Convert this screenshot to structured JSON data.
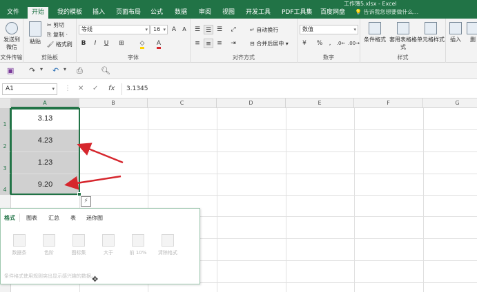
{
  "window": {
    "title": "工作簿5.xlsx - Excel"
  },
  "tabs": [
    "文件",
    "开始",
    "我的模板",
    "插入",
    "页面布局",
    "公式",
    "数据",
    "审阅",
    "视图",
    "开发工具",
    "PDF工具集",
    "百度网盘"
  ],
  "active_tab": "开始",
  "tell_me": "告诉我您想要做什么...",
  "ribbon": {
    "sendwechat": {
      "label": "发送到微信",
      "group": "文件传输"
    },
    "clipboard": {
      "paste": "粘贴",
      "cut": "剪切",
      "copy": "复制 ·",
      "format_painter": "格式刷",
      "group": "剪贴板"
    },
    "font": {
      "name": "等线",
      "size": "16",
      "grow": "A",
      "shrink": "A",
      "bold": "B",
      "italic": "I",
      "underline": "U",
      "group": "字体"
    },
    "alignment": {
      "wrap": "自动换行",
      "merge": "合并后居中",
      "group": "对齐方式"
    },
    "number": {
      "format": "数值",
      "percent": "%",
      "comma": ",",
      "group": "数字"
    },
    "styles": {
      "conditional": "条件格式",
      "table": "套用表格格式",
      "cell_styles": "单元格样式",
      "group": "样式"
    },
    "cells": {
      "insert": "插入",
      "delete": "删"
    }
  },
  "formula_bar": {
    "name_box": "A1",
    "formula": "3.1345"
  },
  "columns": [
    "A",
    "B",
    "C",
    "D",
    "E",
    "F",
    "G"
  ],
  "rows": [
    "1",
    "2",
    "3",
    "4"
  ],
  "cells": [
    "3.13",
    "4.23",
    "1.23",
    "9.20"
  ],
  "quick_analysis": {
    "tabs": [
      "格式",
      "图表",
      "汇总",
      "表",
      "迷你图"
    ],
    "active": "格式",
    "items": [
      "数据条",
      "色阶",
      "图标集",
      "大于",
      "前 10%",
      "清除格式"
    ],
    "description": "条件格式使用规则突出显示感兴趣的数据。"
  },
  "colors": {
    "excel_green": "#217346",
    "arrow_red": "#d6262d",
    "selection": "#d0d0d0"
  }
}
